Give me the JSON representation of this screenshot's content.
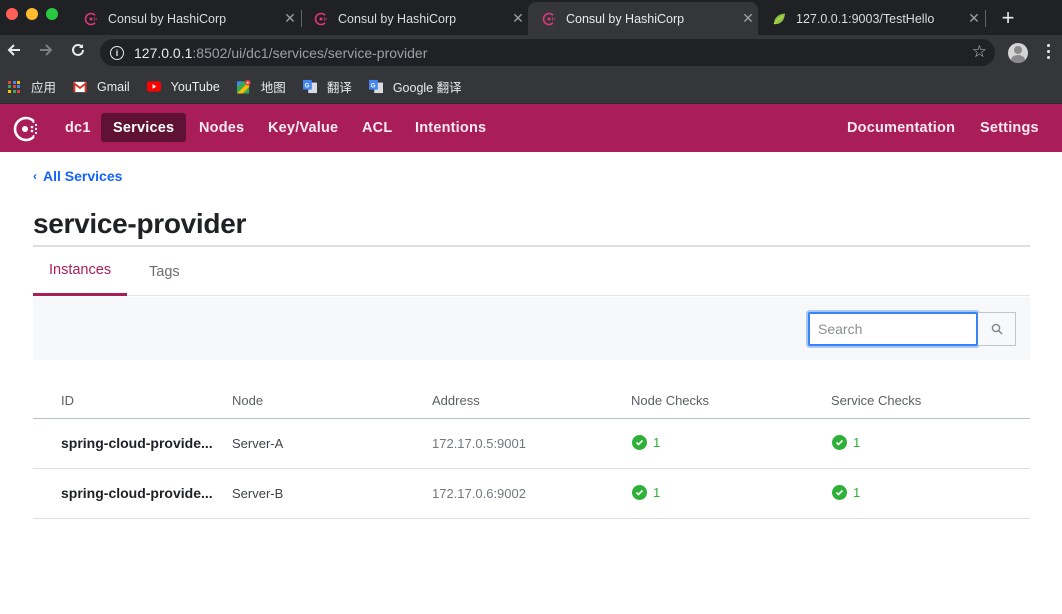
{
  "browser": {
    "tabs": [
      {
        "title": "Consul by HashiCorp",
        "favicon": "consul-icon",
        "active": false
      },
      {
        "title": "Consul by HashiCorp",
        "favicon": "consul-icon",
        "active": false
      },
      {
        "title": "Consul by HashiCorp",
        "favicon": "consul-icon",
        "active": true
      },
      {
        "title": "127.0.0.1:9003/TestHello",
        "favicon": "spring-leaf-icon",
        "active": false
      }
    ],
    "close_glyph": "✕",
    "new_tab_glyph": "+",
    "url_host": "127.0.0.1",
    "url_rest": ":8502/ui/dc1/services/service-provider",
    "bookmarks": [
      {
        "label": "应用",
        "icon": "apps-grid-icon"
      },
      {
        "label": "Gmail",
        "icon": "gmail-icon"
      },
      {
        "label": "YouTube",
        "icon": "youtube-icon"
      },
      {
        "label": "地图",
        "icon": "maps-icon"
      },
      {
        "label": "翻译",
        "icon": "translate-icon"
      },
      {
        "label": "Google 翻译",
        "icon": "translate-icon"
      }
    ]
  },
  "consul": {
    "brand_color": "#a91e59",
    "datacenter": "dc1",
    "nav": [
      {
        "label": "Services",
        "active": true
      },
      {
        "label": "Nodes",
        "active": false
      },
      {
        "label": "Key/Value",
        "active": false
      },
      {
        "label": "ACL",
        "active": false
      },
      {
        "label": "Intentions",
        "active": false
      }
    ],
    "nav_right": [
      {
        "label": "Documentation"
      },
      {
        "label": "Settings"
      }
    ]
  },
  "page": {
    "breadcrumb": "All Services",
    "title": "service-provider",
    "tabs": [
      {
        "label": "Instances",
        "active": true
      },
      {
        "label": "Tags",
        "active": false
      }
    ],
    "search": {
      "placeholder": "Search",
      "value": ""
    },
    "table": {
      "columns": [
        "ID",
        "Node",
        "Address",
        "Node Checks",
        "Service Checks"
      ],
      "rows": [
        {
          "id": "spring-cloud-provide...",
          "node": "Server-A",
          "address": "172.17.0.5:9001",
          "node_checks": "1",
          "service_checks": "1",
          "status": "passing"
        },
        {
          "id": "spring-cloud-provide...",
          "node": "Server-B",
          "address": "172.17.0.6:9002",
          "node_checks": "1",
          "service_checks": "1",
          "status": "passing"
        }
      ]
    }
  }
}
